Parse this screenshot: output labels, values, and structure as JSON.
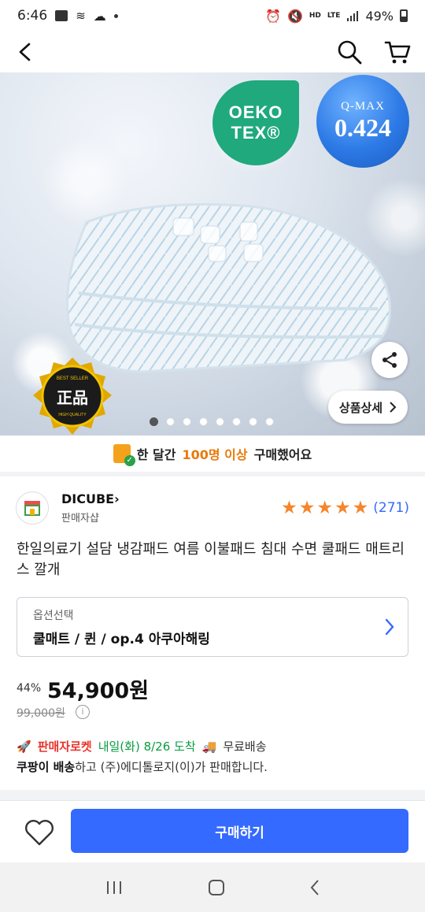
{
  "status_bar": {
    "time": "6:46",
    "battery": "49%",
    "net1": "HD",
    "net2": "LTE"
  },
  "app_bar": {
    "icons": [
      "back-icon",
      "search-icon",
      "cart-icon"
    ]
  },
  "hero": {
    "oeko_line1": "OEKO",
    "oeko_line2": "TEX®",
    "qmax_line1": "Q-MAX",
    "qmax_line2": "0.424",
    "badge_text": "正品",
    "badge_ring": "BEST SELLER",
    "badge_bottom": "HIGH QUALITY",
    "detail_button": "상품상세",
    "slide_count": 8,
    "active_slide": 1
  },
  "notice": {
    "prefix": "한 달간",
    "highlight": "100명 이상",
    "suffix": "구매했어요"
  },
  "seller": {
    "name": "DICUBE",
    "subtitle": "판매자샵",
    "rating": 5,
    "review_count": "(271)"
  },
  "product": {
    "title": "한일의료기 설담 냉감패드 여름 이불패드 침대 수면 쿨패드 매트리스 깔개"
  },
  "option": {
    "label": "옵션선택",
    "value": "쿨매트 / 퀸 / op.4 아쿠아해링"
  },
  "price": {
    "discount": "44%",
    "sale_price": "54,900원",
    "original_price": "99,000원"
  },
  "delivery": {
    "rocket_label": "판매자로켓",
    "arrival": "내일(화) 8/26 도착",
    "free_shipping": "무료배송",
    "sold_by_bold": "쿠팡이 배송",
    "sold_by_rest": "하고 (주)에디톨로지(이)가 판매합니다."
  },
  "actions": {
    "buy_label": "구매하기"
  },
  "colors": {
    "primary_blue": "#346aff",
    "star_orange": "#f5862b",
    "rocket_red": "#e8332c",
    "arrival_green": "#0a9b3f",
    "oeko_green": "#1fa97c"
  }
}
